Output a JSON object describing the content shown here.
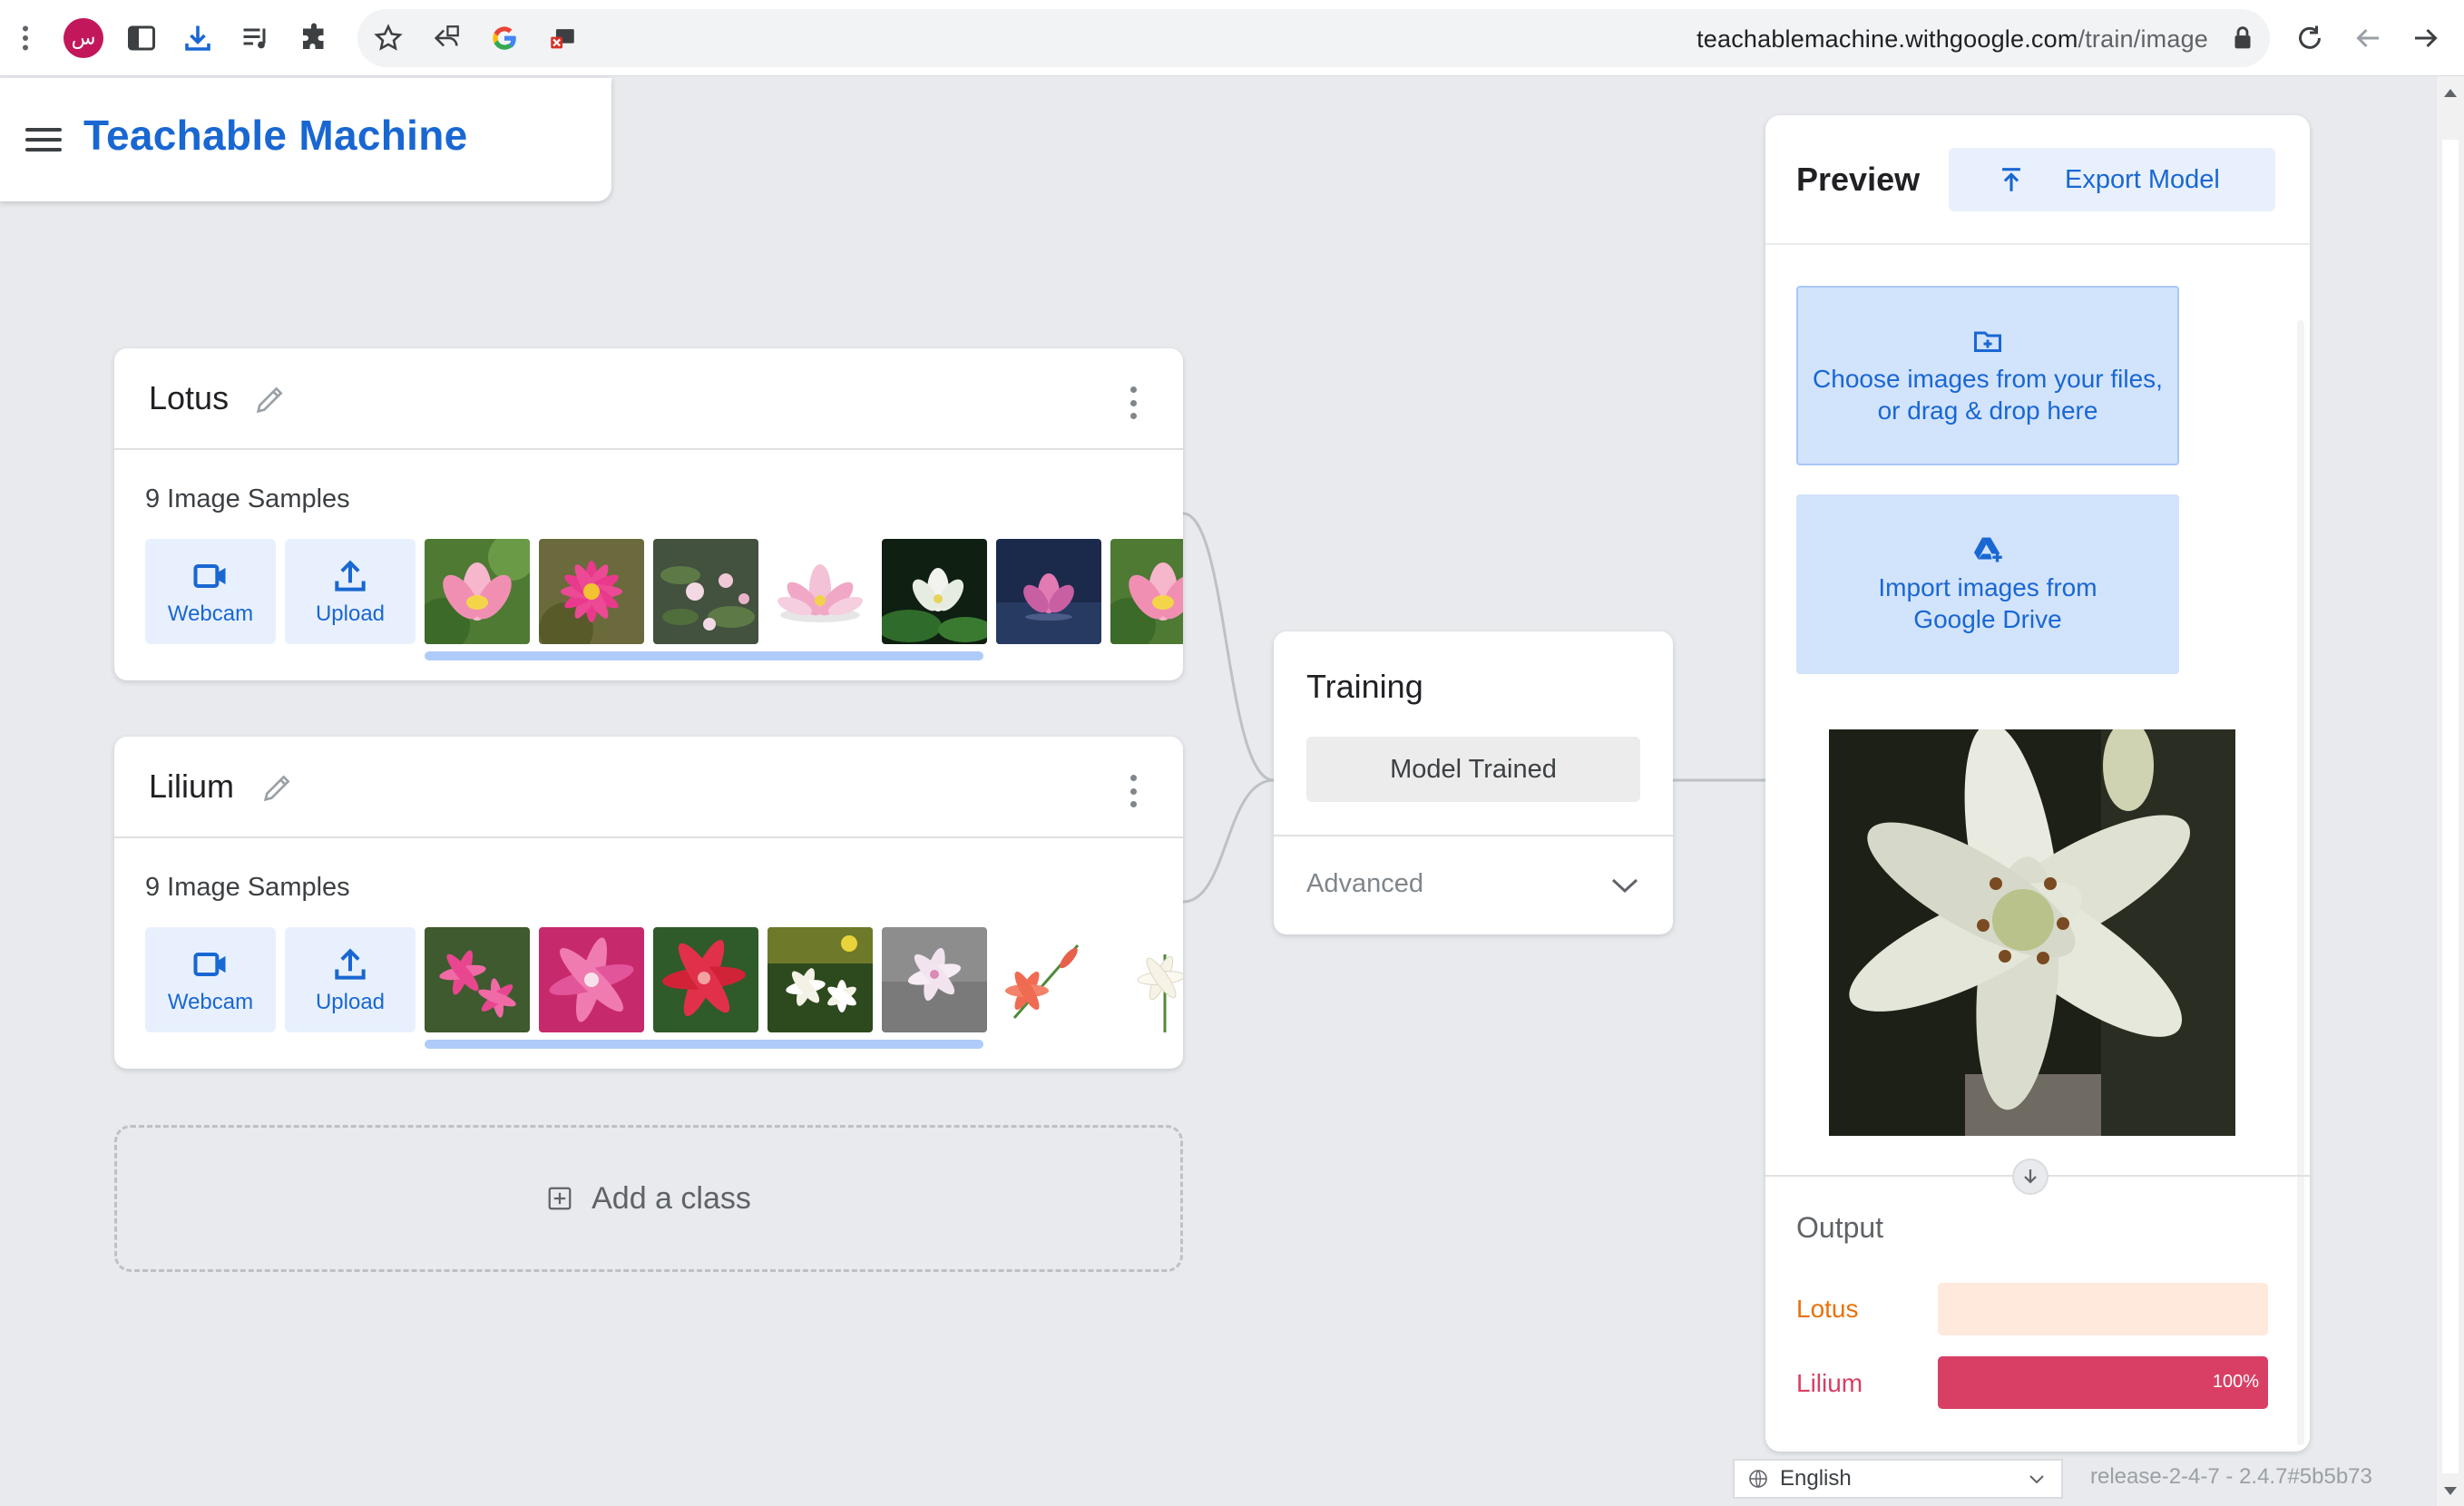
{
  "browser": {
    "avatar_letter": "س",
    "url_host": "teachablemachine.withgoogle.com",
    "url_path": "/train/image"
  },
  "app": {
    "title": "Teachable Machine"
  },
  "classes": [
    {
      "name": "Lotus",
      "samples_label": "9 Image Samples",
      "webcam_label": "Webcam",
      "upload_label": "Upload"
    },
    {
      "name": "Lilium",
      "samples_label": "9 Image Samples",
      "webcam_label": "Webcam",
      "upload_label": "Upload"
    }
  ],
  "add_class_label": "Add a class",
  "training": {
    "title": "Training",
    "button_label": "Model Trained",
    "advanced_label": "Advanced"
  },
  "preview": {
    "title": "Preview",
    "export_label": "Export Model",
    "choose_files_line1": "Choose images from your files,",
    "choose_files_line2": "or drag & drop here",
    "drive_line1": "Import images from",
    "drive_line2": "Google Drive",
    "output_title": "Output",
    "outputs": [
      {
        "label": "Lotus",
        "percent": 0,
        "percent_text": "",
        "color": "#e8710a",
        "track_color": "#fee9dc"
      },
      {
        "label": "Lilium",
        "percent": 100,
        "percent_text": "100%",
        "color": "#d93f64",
        "track_color": "#fce4ea"
      }
    ]
  },
  "footer": {
    "language": "English",
    "release": "release-2-4-7 - 2.4.7#5b5b73"
  },
  "colors": {
    "accent": "#1967d2",
    "accent_light": "#e8f0fe"
  }
}
